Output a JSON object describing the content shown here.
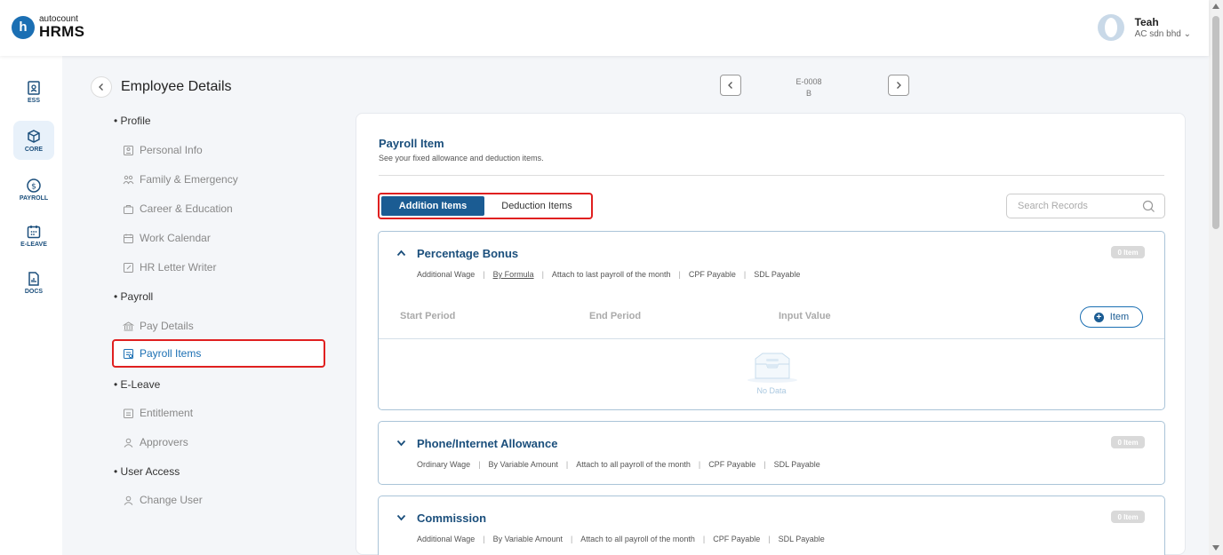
{
  "brand": {
    "top": "autocount",
    "bottom": "HRMS",
    "mark": "h"
  },
  "user": {
    "name": "Teah",
    "company": "AC sdn bhd"
  },
  "rail": [
    {
      "label": "ESS",
      "icon": "ess-icon",
      "active": false
    },
    {
      "label": "CORE",
      "icon": "core-icon",
      "active": true
    },
    {
      "label": "PAYROLL",
      "icon": "payroll-icon",
      "active": false
    },
    {
      "label": "E-LEAVE",
      "icon": "calendar-icon",
      "active": false
    },
    {
      "label": "DOCS",
      "icon": "docs-icon",
      "active": false
    }
  ],
  "subnav": {
    "title": "Employee Details",
    "sections": [
      {
        "label": "Profile",
        "items": [
          "Personal Info",
          "Family & Emergency",
          "Career & Education",
          "Work Calendar",
          "HR Letter Writer"
        ]
      },
      {
        "label": "Payroll",
        "items": [
          "Pay Details",
          "Payroll Items"
        ]
      },
      {
        "label": "E-Leave",
        "items": [
          "Entitlement",
          "Approvers"
        ]
      },
      {
        "label": "User Access",
        "items": [
          "Change User"
        ]
      }
    ],
    "active_item": "Payroll Items"
  },
  "employee": {
    "code": "E-0008",
    "name": "B"
  },
  "page": {
    "title": "Payroll Item",
    "subtitle": "See your fixed allowance and deduction items.",
    "tabs": {
      "addition": "Addition Items",
      "deduction": "Deduction Items",
      "active": "addition"
    },
    "search_placeholder": "Search Records"
  },
  "items": [
    {
      "name": "Percentage Bonus",
      "expanded": true,
      "badge": "0 Item",
      "wage_type": "Additional Wage",
      "method": "By Formula",
      "attach": "Attach to last payroll of the month",
      "cpf": "CPF Payable",
      "sdl": "SDL Payable",
      "columns": [
        "Start Period",
        "End Period",
        "Input Value"
      ],
      "add_label": "Item",
      "empty_text": "No Data"
    },
    {
      "name": "Phone/Internet Allowance",
      "expanded": false,
      "badge": "0 Item",
      "wage_type": "Ordinary Wage",
      "method": "By Variable Amount",
      "attach": "Attach to all payroll of the month",
      "cpf": "CPF Payable",
      "sdl": "SDL Payable"
    },
    {
      "name": "Commission",
      "expanded": false,
      "badge": "0 Item",
      "wage_type": "Additional Wage",
      "method": "By Variable Amount",
      "attach": "Attach to all payroll of the month",
      "cpf": "CPF Payable",
      "sdl": "SDL Payable"
    }
  ],
  "colors": {
    "primary": "#1b5c93",
    "accent": "#1b6fb3",
    "highlight": "#e02020"
  }
}
